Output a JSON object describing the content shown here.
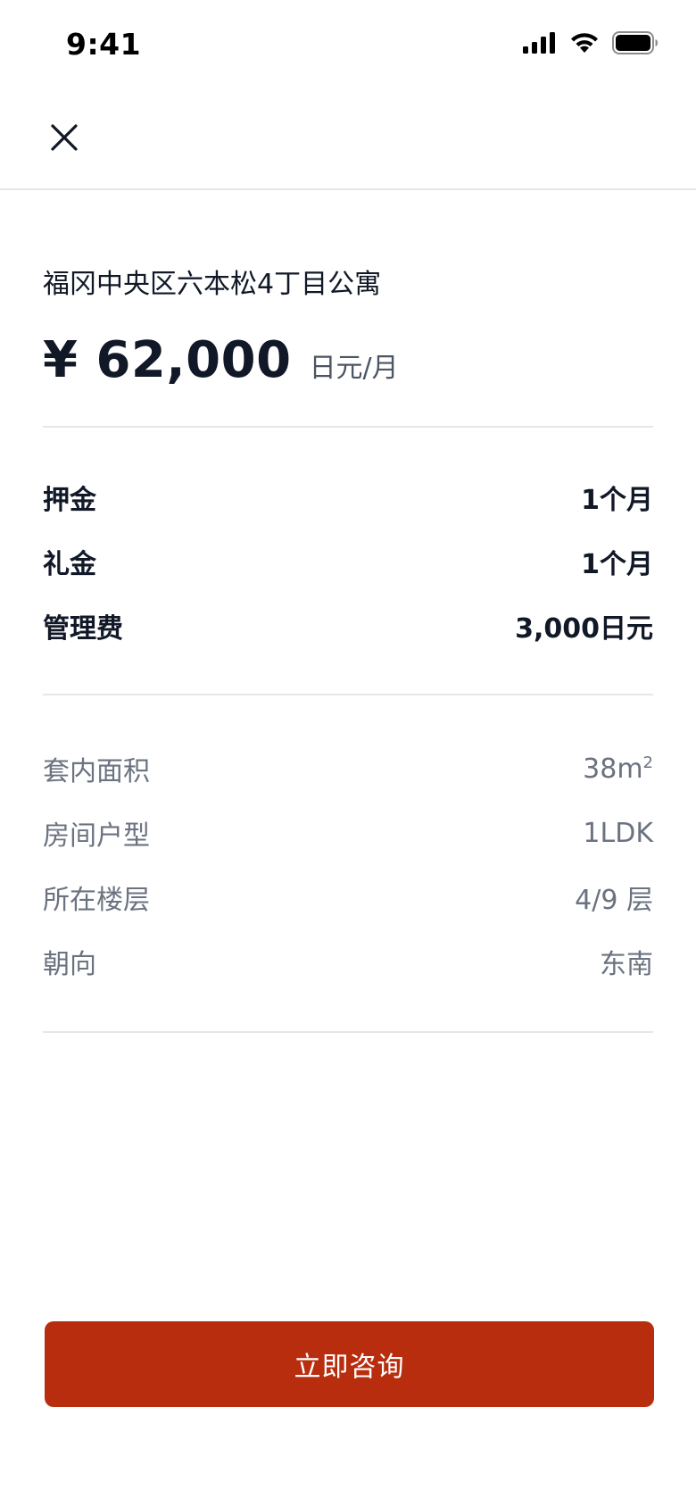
{
  "status_bar": {
    "time": "9:41",
    "icons": [
      "cellular-signal-icon",
      "wifi-icon",
      "battery-icon"
    ]
  },
  "nav": {
    "close_icon": "close-icon"
  },
  "listing": {
    "title": "福冈中央区六本松4丁目公寓",
    "price": "¥ 62,000",
    "price_unit": "日元/月"
  },
  "fees": [
    {
      "label": "押金",
      "value": "1个月"
    },
    {
      "label": "礼金",
      "value": "1个月"
    },
    {
      "label": "管理费",
      "value": "3,000日元"
    }
  ],
  "specs": [
    {
      "label": "套内面积",
      "value": "38m",
      "value_sup": "2"
    },
    {
      "label": "房间户型",
      "value": "1LDK"
    },
    {
      "label": "所在楼层",
      "value": "4/9 层"
    },
    {
      "label": "朝向",
      "value": "东南"
    }
  ],
  "actions": {
    "consult_label": "立即咨询"
  },
  "colors": {
    "primary_button": "#b92d0f",
    "text_primary": "#111827",
    "text_secondary": "#6b7280",
    "divider": "#e5e7eb"
  }
}
